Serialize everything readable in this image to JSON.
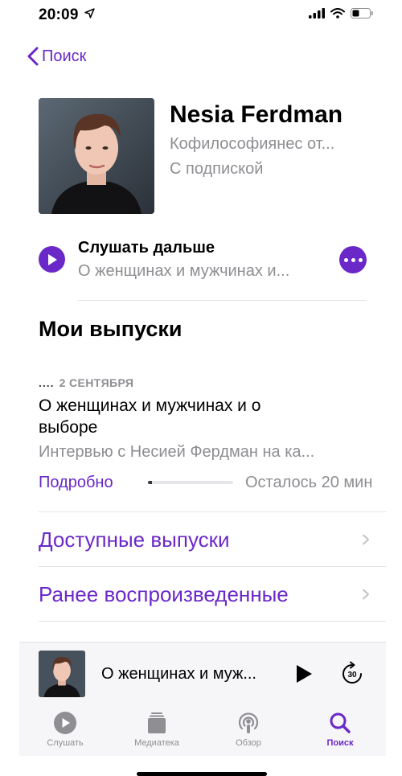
{
  "status_bar": {
    "time": "20:09"
  },
  "nav": {
    "back_label": "Поиск"
  },
  "podcast": {
    "author": "Nesia Ferdman",
    "subtitle": "Кофилософиянес от...",
    "status": "С подпиской"
  },
  "continue": {
    "title": "Слушать дальше",
    "episode": "О женщинах и мужчинах и..."
  },
  "section": {
    "title": "Мои выпуски"
  },
  "episode": {
    "dots": "....",
    "date": "2 СЕНТЯБРЯ",
    "title": "О женщинах и мужчинах и о выборе",
    "description": "Интервью с Несией Фердман на ка...",
    "details_label": "Подробно",
    "progress": 0.05,
    "remaining": "Осталось 20 мин"
  },
  "links": [
    {
      "label": "Доступные выпуски"
    },
    {
      "label": "Ранее воспроизведенные"
    }
  ],
  "mini_player": {
    "title": "О женщинах и муж...",
    "skip_seconds": "30"
  },
  "tabs": [
    {
      "label": "Слушать",
      "icon": "play-circle-icon"
    },
    {
      "label": "Медиатека",
      "icon": "library-icon"
    },
    {
      "label": "Обзор",
      "icon": "podcasts-icon"
    },
    {
      "label": "Поиск",
      "icon": "search-icon",
      "active": true
    }
  ],
  "colors": {
    "accent": "#6a28c8",
    "secondary_text": "#8e8e93"
  }
}
